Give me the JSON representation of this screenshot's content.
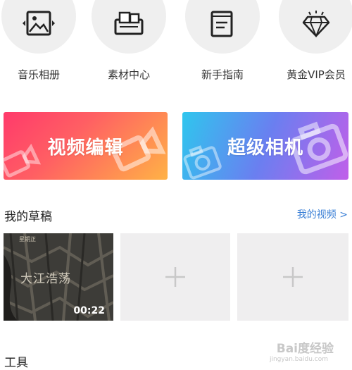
{
  "features": [
    {
      "label": "音乐相册",
      "icon": "photo-album-icon"
    },
    {
      "label": "素材中心",
      "icon": "material-box-icon"
    },
    {
      "label": "新手指南",
      "icon": "guide-book-icon"
    },
    {
      "label": "黄金VIP会员",
      "icon": "diamond-icon"
    }
  ],
  "banners": {
    "video_edit": "视频编辑",
    "super_camera": "超级相机"
  },
  "drafts": {
    "title": "我的草稿",
    "my_videos_link": "我的视频 >",
    "items": [
      {
        "thumb_text": "大江浩荡",
        "thumb_small": "星期正",
        "duration": "00:22"
      }
    ],
    "add_icon": "plus-icon"
  },
  "tools": {
    "title": "工具"
  },
  "watermark": {
    "text": "Bai度经验",
    "sub": "jingyan.baidu.com"
  },
  "colors": {
    "link": "#3a7fd6",
    "edit_gradient_start": "#ff3a6b",
    "edit_gradient_end": "#ffb246",
    "camera_gradient_start": "#2fc6ee",
    "camera_gradient_end": "#c05fe9"
  }
}
